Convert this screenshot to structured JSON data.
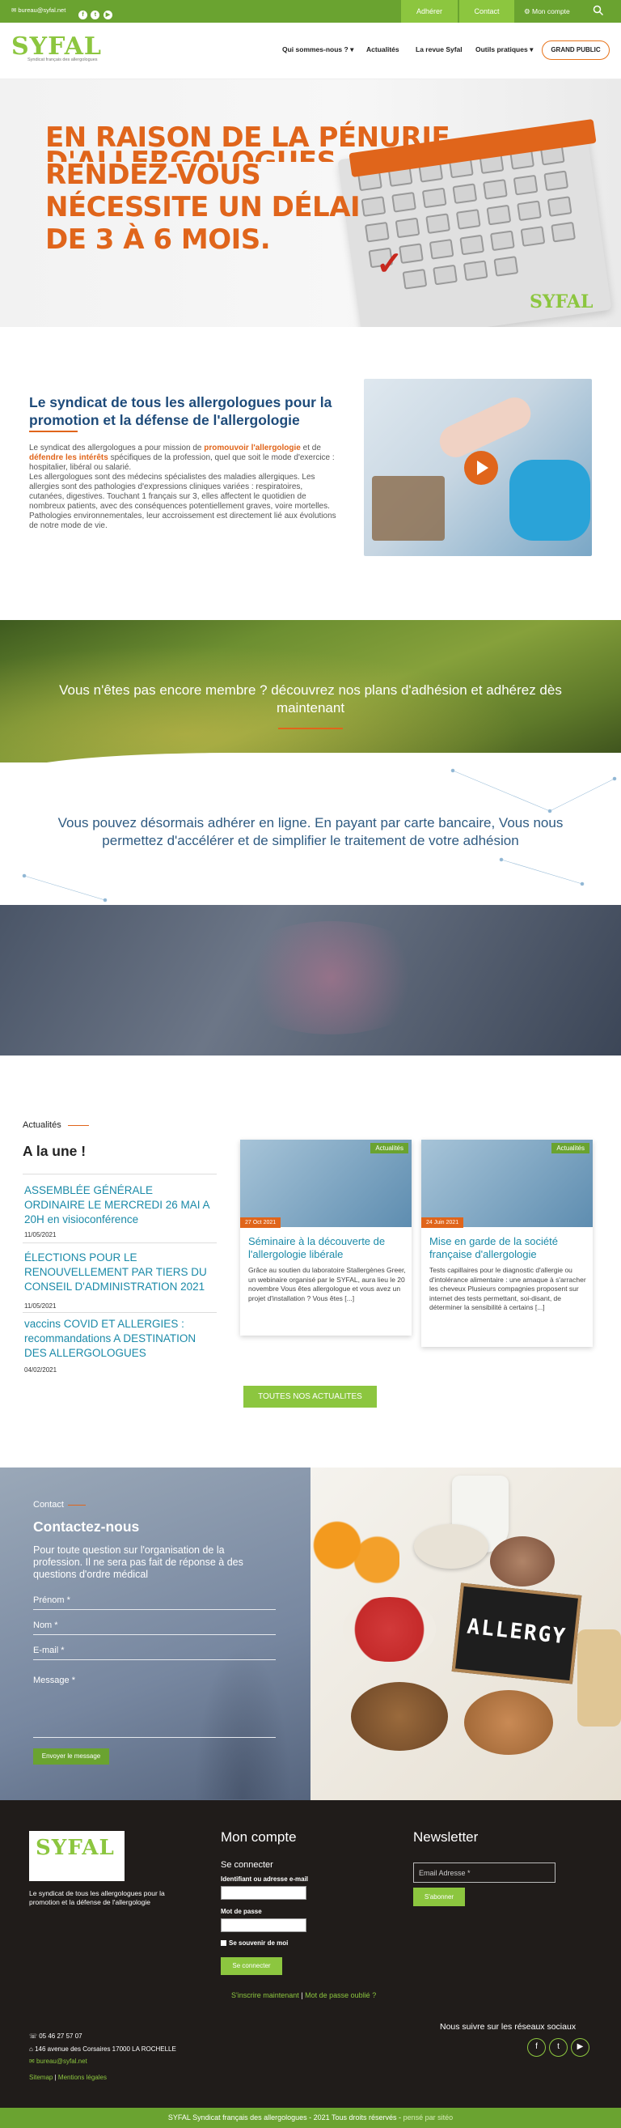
{
  "topbar": {
    "email": "bureau@syfal.net",
    "social_icons": [
      "facebook-icon",
      "twitter-icon",
      "youtube-icon"
    ],
    "adherer": "Adhérer",
    "contact": "Contact",
    "account": "Mon compte"
  },
  "header": {
    "logo_text": "SYFAL",
    "logo_sub": "Syndicat français des allergologues",
    "nav": [
      "Qui sommes-nous ?",
      "Actualités",
      "La revue Syfal",
      "Outils pratiques"
    ],
    "grand_public": "GRAND PUBLIC"
  },
  "hero": {
    "line1": "EN RAISON DE LA PÉNURIE",
    "line2": "D'ALLERGOLOGUES",
    "line3": "RENDEZ-VOUS",
    "line4": "NÉCESSITE UN DÉLAI",
    "line5": "DE 3 À 6 MOIS.",
    "logo": "SYFAL"
  },
  "intro": {
    "title": "Le syndicat de tous les allergologues pour la promotion et la défense de l'allergologie",
    "p1_a": "Le syndicat des allergologues a pour mission de ",
    "p1_b": "promouvoir l'allergologie",
    "p1_c": " et de ",
    "p1_d": "défendre les intérêts",
    "p1_e": " spécifiques de la profession, quel que soit le mode d'exercice : hospitalier, libéral ou salarié.",
    "p2": "Les allergologues sont des médecins spécialistes des maladies allergiques. Les allergies sont des pathologies d'expressions  cliniques variées : respiratoires, cutanées, digestives. Touchant 1 français sur 3, elles affectent le quotidien de nombreux patients, avec des conséquences potentiellement graves, voire mortelles. Pathologies environnementales, leur accroissement est directement lié aux évolutions de notre mode de vie."
  },
  "bands": {
    "b1": "Vous n'êtes pas encore membre ? découvrez nos plans d'adhésion et adhérez dès maintenant",
    "b2": "Vous pouvez désormais adhérer en ligne. En payant par carte bancaire, Vous nous permettez d'accélérer et de simplifier le traitement de votre adhésion"
  },
  "news": {
    "section": "Actualités",
    "heading": "A la une !",
    "items": [
      {
        "title": "ASSEMBLÉE GÉNÉRALE ORDINAIRE LE MERCREDI 26 MAI A 20H en visioconférence",
        "date": "11/05/2021"
      },
      {
        "title": "ÉLECTIONS POUR LE RENOUVELLEMENT PAR TIERS DU CONSEIL D'ADMINISTRATION 2021",
        "date": "11/05/2021"
      },
      {
        "title": "vaccins COVID ET ALLERGIES : recommandations A DESTINATION DES ALLERGOLOGUES",
        "date": "04/02/2021"
      }
    ],
    "cards": [
      {
        "tag": "Actualités",
        "date": "27 Oct 2021",
        "title": "Séminaire à la découverte de l'allergologie libérale",
        "text": "Grâce au soutien du laboratoire Stallergènes Greer, un webinaire organisé par le SYFAL, aura lieu le 20 novembre Vous êtes allergologue et vous avez un projet d'installation ? Vous êtes [...]"
      },
      {
        "tag": "Actualités",
        "date": "24 Juin 2021",
        "title": "Mise en garde de la société française d'allergologie",
        "text": "Tests capillaires pour le diagnostic d'allergie ou d'intolérance alimentaire : une arnaque à s'arracher les cheveux Plusieurs compagnies proposent sur internet des tests permettant, soi-disant, de déterminer la sensibilité à certains [...]"
      }
    ],
    "all_button": "TOUTES NOS ACTUALITES"
  },
  "contact": {
    "section": "Contact",
    "heading": "Contactez-nous",
    "text": "Pour toute question sur l'organisation de la profession. Il ne sera pas fait de réponse à des questions d'ordre médical",
    "prenom": "Prénom *",
    "nom": "Nom *",
    "email": "E-mail *",
    "message": "Message *",
    "send": "Envoyer le message",
    "image_word": "ALLERGY"
  },
  "footer": {
    "logo_text": "SYFAL",
    "tagline": "Le syndicat de tous les allergologues pour la promotion et la défense de l'allergologie",
    "account_title": "Mon compte",
    "login_title": "Se connecter",
    "id_label": "Identifiant ou adresse e-mail",
    "pwd_label": "Mot de passe",
    "remember": "Se souvenir de moi",
    "login_btn": "Se connecter",
    "register": "S'inscrire maintenant",
    "lost": "Mot de passe oublié ?",
    "newsletter_title": "Newsletter",
    "newsletter_placeholder": "Email Adresse *",
    "subscribe": "S'abonner",
    "phone": "05 46 27 57 07",
    "address": "146 avenue des Corsaires 17000 LA ROCHELLE",
    "mail": "bureau@syfal.net",
    "sitemap": "Sitemap",
    "legal": "Mentions légales",
    "follow": "Nous suivre sur les réseaux sociaux",
    "copyright": "SYFAL Syndicat français des allergologues - 2021 Tous droits réservés -",
    "credit": "pensé par sitéo"
  },
  "colors": {
    "green": "#6aa330",
    "light_green": "#8cc63f",
    "orange": "#e0651b",
    "blue": "#1e4b7a",
    "teal": "#1b8aa8"
  }
}
